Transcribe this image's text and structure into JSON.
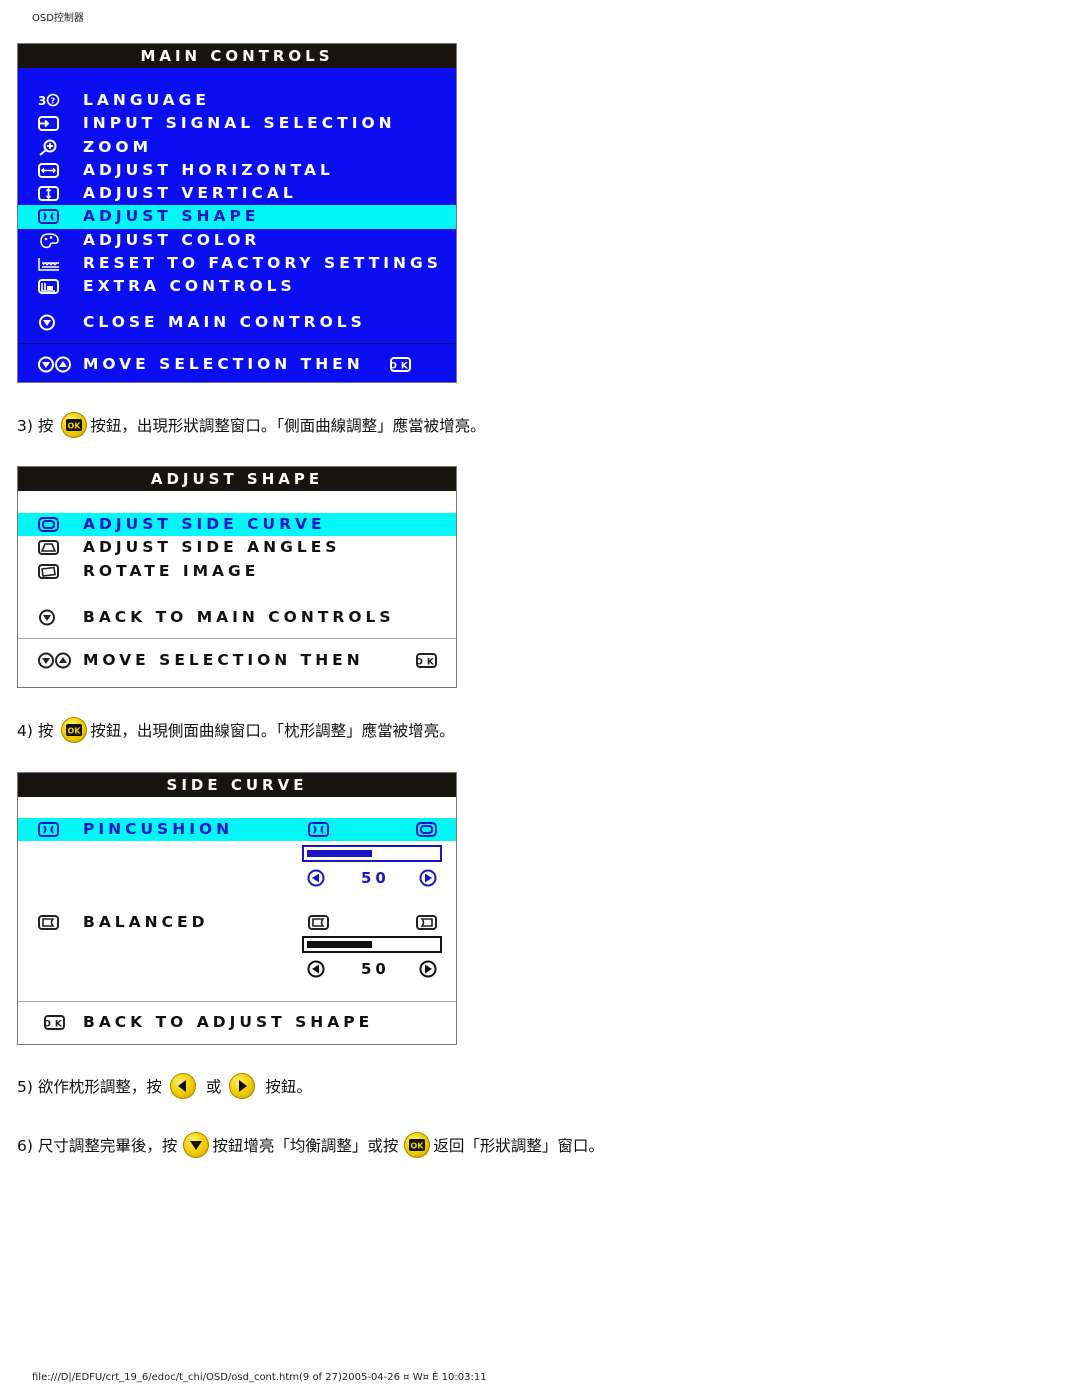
{
  "header": {
    "title": "OSD控制器"
  },
  "main_controls": {
    "title": "MAIN CONTROLS",
    "items": [
      {
        "label": "LANGUAGE",
        "icon": "language-icon",
        "selected": false
      },
      {
        "label": "INPUT SIGNAL SELECTION",
        "icon": "input-signal-icon",
        "selected": false
      },
      {
        "label": "ZOOM",
        "icon": "zoom-icon",
        "selected": false
      },
      {
        "label": "ADJUST HORIZONTAL",
        "icon": "horizontal-arrows-icon",
        "selected": false
      },
      {
        "label": "ADJUST VERTICAL",
        "icon": "vertical-arrows-icon",
        "selected": false
      },
      {
        "label": "ADJUST SHAPE",
        "icon": "shape-icon",
        "selected": true
      },
      {
        "label": "ADJUST COLOR",
        "icon": "palette-icon",
        "selected": false
      },
      {
        "label": "RESET TO FACTORY SETTINGS",
        "icon": "factory-icon",
        "selected": false
      },
      {
        "label": "EXTRA CONTROLS",
        "icon": "extra-controls-icon",
        "selected": false
      }
    ],
    "close_label": "CLOSE MAIN CONTROLS",
    "footer_label": "MOVE SELECTION THEN"
  },
  "step3": {
    "prefix": "3) 按",
    "text": "按鈕，出現形狀調整窗口。「側面曲線調整」應當被增亮。"
  },
  "adjust_shape": {
    "title": "ADJUST SHAPE",
    "items": [
      {
        "label": "ADJUST SIDE CURVE",
        "icon": "side-curve-icon",
        "selected": true
      },
      {
        "label": "ADJUST SIDE ANGLES",
        "icon": "side-angles-icon",
        "selected": false
      },
      {
        "label": "ROTATE IMAGE",
        "icon": "rotate-image-icon",
        "selected": false
      }
    ],
    "back_label": "BACK TO MAIN CONTROLS",
    "footer_label": "MOVE SELECTION THEN"
  },
  "step4": {
    "prefix": "4) 按",
    "text": "按鈕，出現側面曲線窗口。「枕形調整」應當被增亮。"
  },
  "side_curve": {
    "title": "SIDE CURVE",
    "pincushion": {
      "label": "PINCUSHION",
      "value": "50",
      "fraction": 0.5
    },
    "balanced": {
      "label": "BALANCED",
      "value": "50",
      "fraction": 0.5
    },
    "back_label": "BACK TO ADJUST SHAPE"
  },
  "step5": {
    "prefix": "5) 欲作枕形調整，按",
    "middle": "或",
    "suffix": "按鈕。"
  },
  "step6": {
    "prefix": "6) 尺寸調整完畢後，按",
    "middle": "按鈕增亮「均衡調整」或按",
    "suffix": "返回「形狀調整」窗口。"
  },
  "footer": {
    "path": "file:///D|/EDFU/crt_19_6/edoc/t_chi/OSD/osd_cont.htm(9 of 27)2005-04-26 ¤ W¤ È   10:03:11"
  },
  "colors": {
    "osd_blue": "#0a0ef0",
    "highlight": "#00f8f8",
    "highlight_text": "#1a16c8",
    "title_bar": "#181410",
    "button_yellow": "#f2d000"
  }
}
